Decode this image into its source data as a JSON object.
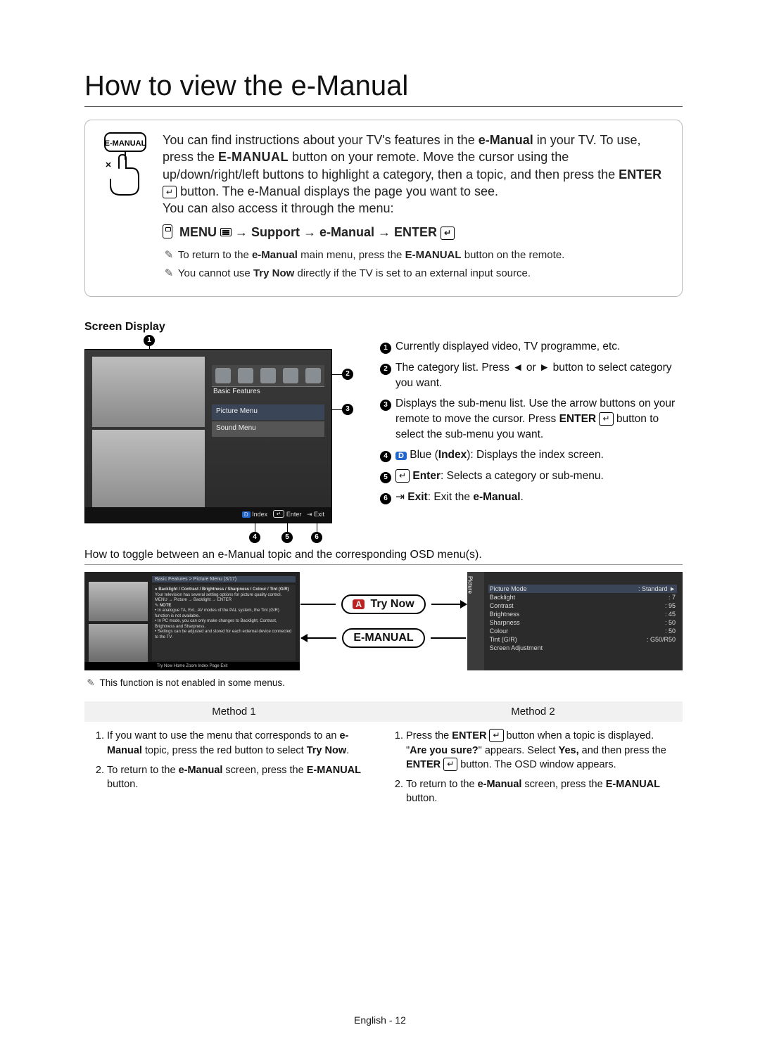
{
  "title": "How to view the e-Manual",
  "intro": {
    "p1_a": "You can find instructions about your TV's features in the ",
    "p1_b": "e-Manual",
    "p1_c": " in your TV. To use, press the ",
    "p1_d": "E-MANUAL",
    "p1_e": " button on your remote. Move the cursor using the up/down/right/left buttons to highlight a category, then a topic, and then press the ",
    "p1_f": "ENTER",
    "p1_g": " button. The e-Manual displays the page you want to see.",
    "p2": "You can also access it through the menu:",
    "path_a": "MENU",
    "path_b": " → Support → e-Manual → ",
    "path_c": "ENTER",
    "note1_a": "To return to the ",
    "note1_b": "e-Manual",
    "note1_c": " main menu, press the ",
    "note1_d": "E-MANUAL",
    "note1_e": " button on the remote.",
    "note2_a": "You cannot use ",
    "note2_b": "Try Now",
    "note2_c": " directly if the TV is set to an external input source."
  },
  "screen_display_label": "Screen Display",
  "screen_mock": {
    "category_label": "Basic Features",
    "menu1": "Picture Menu",
    "menu2": "Sound Menu",
    "footer_index": "Index",
    "footer_enter": "Enter",
    "footer_exit": "Exit"
  },
  "legend": {
    "i1": "Currently displayed video, TV programme, etc.",
    "i2_a": "The category list. Press ",
    "i2_b": " or ",
    "i2_c": " button to select category you want.",
    "i3_a": "Displays the sub-menu list. Use the arrow buttons on your remote to move the cursor. Press ",
    "i3_b": "ENTER",
    "i3_c": " button to select the sub-menu you want.",
    "i4_a": "Blue (",
    "i4_b": "Index",
    "i4_c": "): Displays the index screen.",
    "i5_a": "Enter",
    "i5_b": ": Selects a category or sub-menu.",
    "i6_a": "Exit",
    "i6_b": ": Exit the ",
    "i6_c": "e-Manual",
    "i6_d": "."
  },
  "toggle_heading": "How to toggle between an e-Manual topic and the corresponding OSD menu(s).",
  "mini": {
    "breadcrumb": "Basic Features > Picture Menu (3/17)",
    "bullet_title": "Backlight / Contrast / Brightness / Sharpness / Colour / Tint (G/R)",
    "line1": "Your television has several setting options for picture quality control.",
    "line2": "MENU → Picture → Backlight → ENTER",
    "note_label": "NOTE",
    "n1": "In analogue TA, Ext., AV modes of the PAL system, the Tint (G/R) function is not available.",
    "n2": "In PC mode, you can only make changes to Backlight, Contrast, Brightness and Sharpness.",
    "n3": "Settings can be adjusted and stored for each external device connected to the TV.",
    "footer": "Try Now   Home   Zoom   Index   Page   Exit"
  },
  "pill_try_now_letter": "A",
  "pill_try_now": "Try Now",
  "pill_emanual": "E-MANUAL",
  "osd": {
    "side_label": "Picture",
    "rows": [
      {
        "k": "Picture Mode",
        "v": ": Standard",
        "hi": true
      },
      {
        "k": "Backlight",
        "v": ": 7"
      },
      {
        "k": "Contrast",
        "v": ": 95"
      },
      {
        "k": "Brightness",
        "v": ": 45"
      },
      {
        "k": "Sharpness",
        "v": ": 50"
      },
      {
        "k": "Colour",
        "v": ": 50"
      },
      {
        "k": "Tint (G/R)",
        "v": ": G50/R50"
      },
      {
        "k": "Screen Adjustment",
        "v": ""
      }
    ]
  },
  "toggle_note": "This function is not enabled in some menus.",
  "methods": {
    "h1": "Method 1",
    "h2": "Method 2",
    "m1_1_a": "If you want to use the menu that corresponds to an ",
    "m1_1_b": "e-Manual",
    "m1_1_c": " topic, press the red button to select ",
    "m1_1_d": "Try Now",
    "m1_1_e": ".",
    "m1_2_a": "To return to the ",
    "m1_2_b": "e-Manual",
    "m1_2_c": " screen, press the ",
    "m1_2_d": "E-MANUAL",
    "m1_2_e": " button.",
    "m2_1_a": "Press the ",
    "m2_1_b": "ENTER",
    "m2_1_c": " button when a topic is displayed. \"",
    "m2_1_d": "Are you sure?",
    "m2_1_e": "\" appears. Select ",
    "m2_1_f": "Yes,",
    "m2_1_g": " and then press the ",
    "m2_1_h": "ENTER",
    "m2_1_i": " button. The OSD window appears.",
    "m2_2_a": "To return to the ",
    "m2_2_b": "e-Manual",
    "m2_2_c": " screen, press the ",
    "m2_2_d": "E-MANUAL",
    "m2_2_e": " button."
  },
  "page_footer": "English - 12"
}
